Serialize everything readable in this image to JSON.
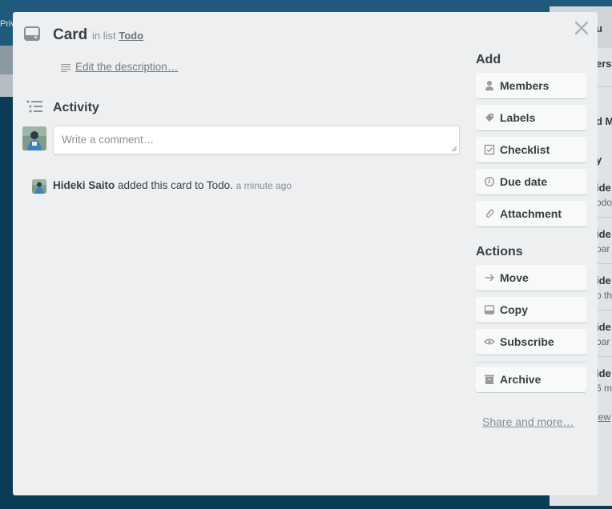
{
  "background": {
    "topbar_text": "Priv",
    "right_panel": {
      "header": "u",
      "lines": [
        "ers",
        "d M",
        "y",
        "ide",
        "odo",
        "ide",
        "oar",
        "ide",
        "o th",
        "ide",
        "oar",
        "ide",
        "6 m",
        "iew"
      ]
    }
  },
  "card": {
    "title": "Card",
    "in_list_prefix": "in list",
    "list_name": "Todo",
    "edit_description": "Edit the description…"
  },
  "activity": {
    "title": "Activity",
    "comment_placeholder": "Write a comment…",
    "entries": [
      {
        "user": "Hideki Saito",
        "action": "added this card to Todo.",
        "time": "a minute ago"
      }
    ]
  },
  "sidebar": {
    "add_title": "Add",
    "add_buttons": [
      {
        "label": "Members",
        "icon": "person-icon"
      },
      {
        "label": "Labels",
        "icon": "tag-icon"
      },
      {
        "label": "Checklist",
        "icon": "checkbox-icon"
      },
      {
        "label": "Due date",
        "icon": "clock-icon"
      },
      {
        "label": "Attachment",
        "icon": "paperclip-icon"
      }
    ],
    "actions_title": "Actions",
    "action_buttons": [
      {
        "label": "Move",
        "icon": "arrow-right-icon"
      },
      {
        "label": "Copy",
        "icon": "card-icon"
      },
      {
        "label": "Subscribe",
        "icon": "eye-icon"
      }
    ],
    "archive_label": "Archive",
    "share_link": "Share and more…"
  }
}
